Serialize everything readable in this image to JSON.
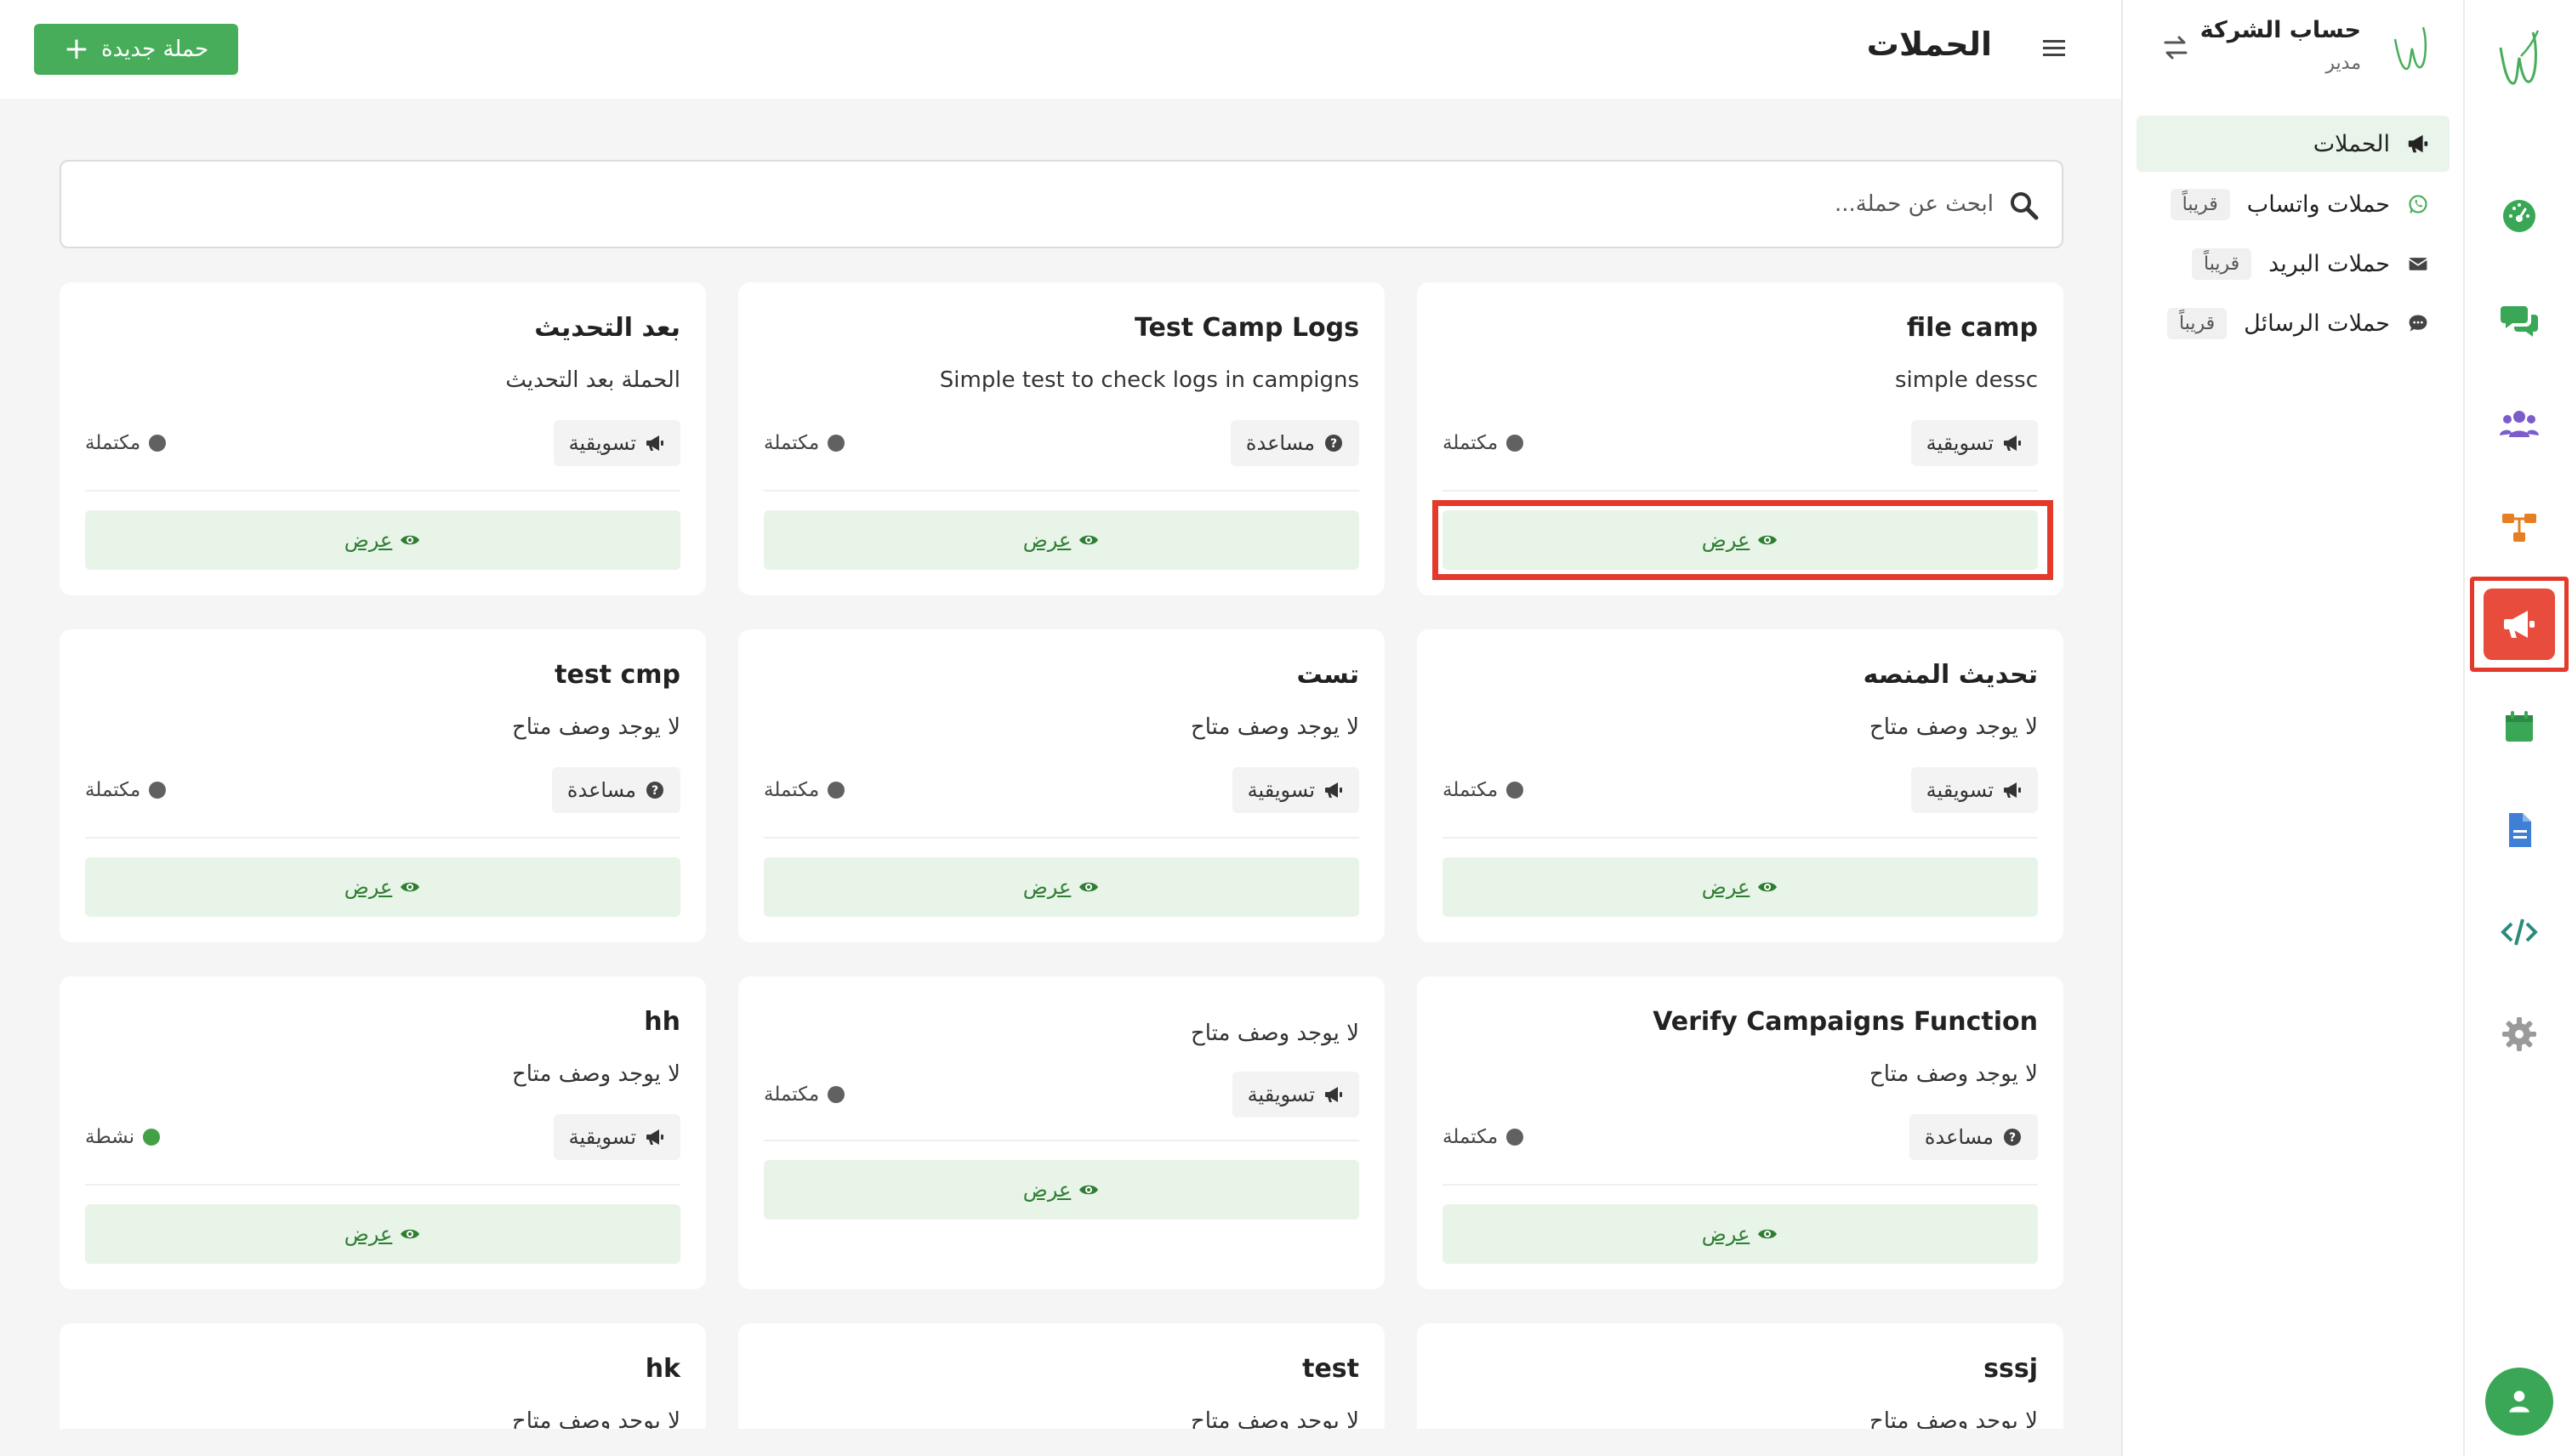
{
  "header": {
    "title": "الحملات",
    "new_campaign_label": "حملة جديدة"
  },
  "account": {
    "name": "حساب الشركة",
    "role": "مدير"
  },
  "sidebar": {
    "items": [
      {
        "label": "الحملات",
        "icon": "megaphone-icon",
        "active": true
      },
      {
        "label": "حملات واتساب",
        "icon": "whatsapp-icon",
        "badge": "قريباً"
      },
      {
        "label": "حملات البريد",
        "icon": "envelope-icon",
        "badge": "قريباً"
      },
      {
        "label": "حملات الرسائل",
        "icon": "sms-icon",
        "badge": "قريباً"
      }
    ]
  },
  "rail": {
    "icons": [
      "dashboard-icon",
      "chat-icon",
      "users-icon",
      "flow-icon",
      "megaphone-icon",
      "calendar-icon",
      "document-icon",
      "code-icon",
      "settings-icon",
      "user-icon"
    ]
  },
  "search": {
    "placeholder": "ابحث عن حملة..."
  },
  "colors": {
    "brand_green": "#48ad5a",
    "accent_red": "#e74c3c",
    "view_bg": "#e8f4e8",
    "status_active": "#43a047",
    "status_done": "#616161"
  },
  "cards": [
    {
      "title": "file camp",
      "description": "simple dessc",
      "type": "تسويقية",
      "type_icon": "megaphone-icon",
      "status": "مكتملة",
      "view": "عرض"
    },
    {
      "title": "Test Camp Logs",
      "description": "Simple test to check logs in campigns",
      "type": "مساعدة",
      "type_icon": "help-icon",
      "status": "مكتملة",
      "view": "عرض"
    },
    {
      "title": "بعد التحديث",
      "description": "الحملة بعد التحديث",
      "type": "تسويقية",
      "type_icon": "megaphone-icon",
      "status": "مكتملة",
      "view": "عرض"
    },
    {
      "title": "تحديث المنصه",
      "description": "لا يوجد وصف متاح",
      "type": "تسويقية",
      "type_icon": "megaphone-icon",
      "status": "مكتملة",
      "view": "عرض"
    },
    {
      "title": "تست",
      "description": "لا يوجد وصف متاح",
      "type": "تسويقية",
      "type_icon": "megaphone-icon",
      "status": "مكتملة",
      "view": "عرض"
    },
    {
      "title": "test cmp",
      "description": "لا يوجد وصف متاح",
      "type": "مساعدة",
      "type_icon": "help-icon",
      "status": "مكتملة",
      "view": "عرض"
    },
    {
      "title": "Verify Campaigns Function",
      "description": "لا يوجد وصف متاح",
      "type": "مساعدة",
      "type_icon": "help-icon",
      "status": "مكتملة",
      "view": "عرض"
    },
    {
      "title": "",
      "description": "لا يوجد وصف متاح",
      "type": "تسويقية",
      "type_icon": "megaphone-icon",
      "status": "مكتملة",
      "view": "عرض"
    },
    {
      "title": "hh",
      "description": "لا يوجد وصف متاح",
      "type": "تسويقية",
      "type_icon": "megaphone-icon",
      "status": "نشطة",
      "view": "عرض"
    },
    {
      "title": "sssj",
      "description": "لا يوجد وصف متاح"
    },
    {
      "title": "test",
      "description": "لا يوجد وصف متاح"
    },
    {
      "title": "hk",
      "description": "لا يوجد وصف متاح"
    }
  ]
}
